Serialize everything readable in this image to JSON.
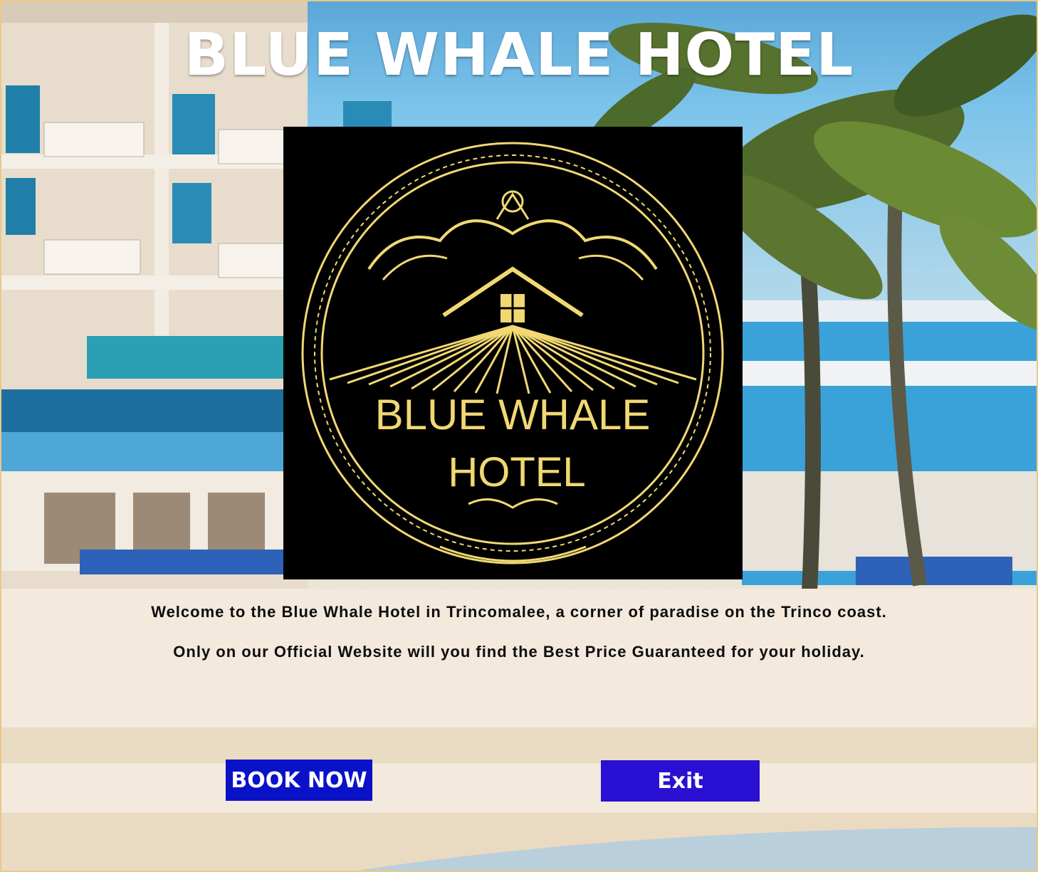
{
  "window": {
    "title": "BLUE WHALE HOTEL"
  },
  "logo": {
    "name_line1": "BLUE WHALE",
    "name_line2": "HOTEL",
    "color": "#f1d872",
    "background": "#000000"
  },
  "welcome": {
    "line1": "Welcome to the Blue Whale Hotel in Trincomalee, a corner of paradise on the Trinco coast.",
    "line2": "Only on our Official Website will you find the Best Price Guaranteed for your holiday."
  },
  "buttons": {
    "book_now": "BOOK NOW",
    "exit": "Exit"
  },
  "colors": {
    "book_button": "#0a12c8",
    "exit_button": "#2a10d2",
    "title_text": "#ffffff"
  }
}
